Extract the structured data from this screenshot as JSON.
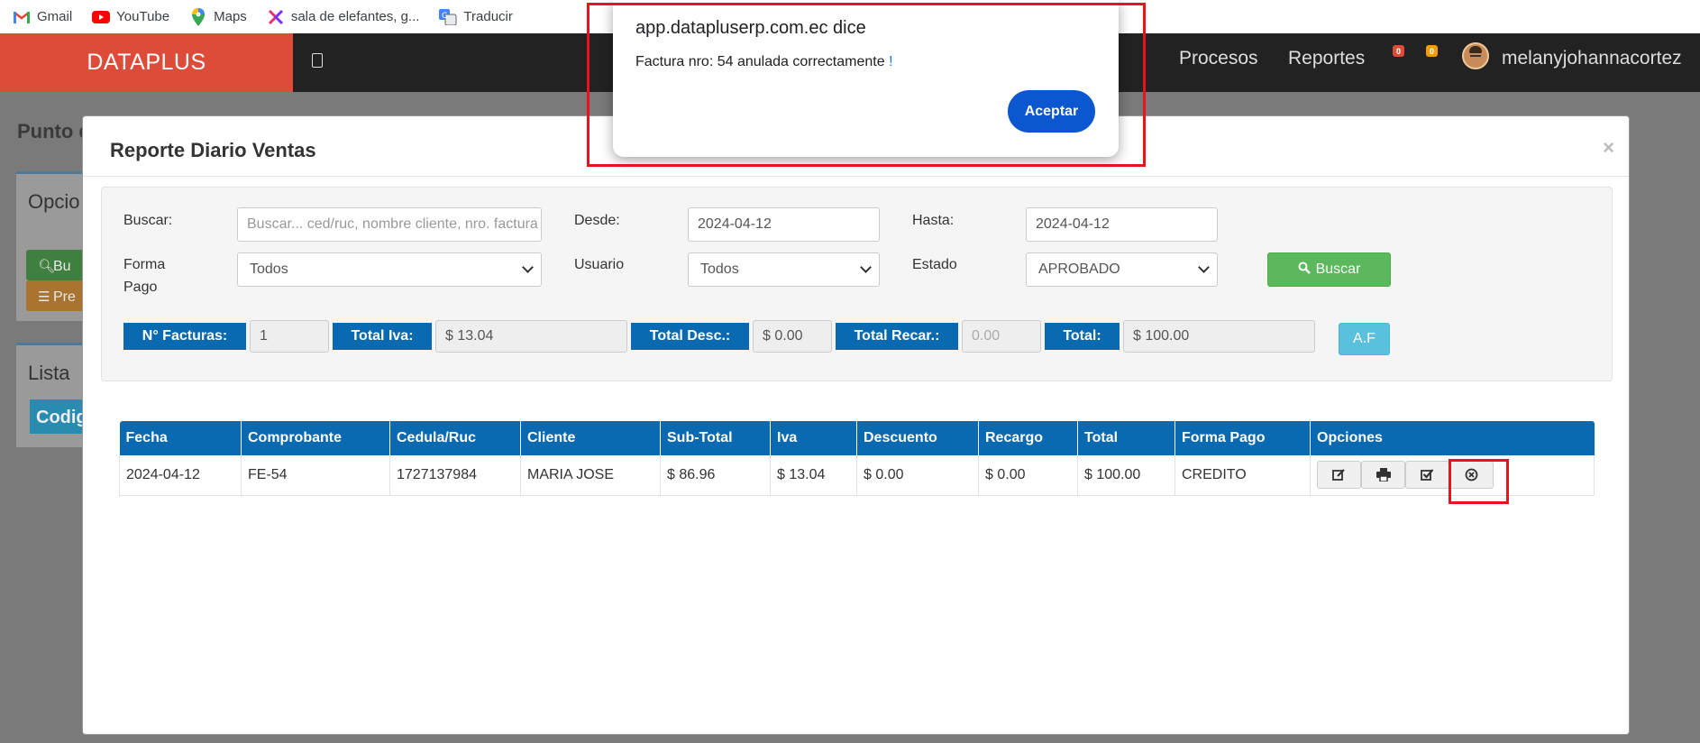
{
  "bookmarks": [
    {
      "label": "Gmail",
      "icon": "gmail-icon"
    },
    {
      "label": "YouTube",
      "icon": "youtube-icon"
    },
    {
      "label": "Maps",
      "icon": "maps-pin-icon"
    },
    {
      "label": "sala de elefantes, g...",
      "icon": "site-logo-icon"
    },
    {
      "label": "Traducir",
      "icon": "translate-icon"
    }
  ],
  "navbar": {
    "brand": "DATAPLUS",
    "links": [
      "Procesos",
      "Reportes"
    ],
    "badges": [
      "0",
      "0"
    ],
    "user": "melanyjohannacortez"
  },
  "background": {
    "page_title": "Punto d",
    "options_title": "Opcio",
    "btn_search": "Bu",
    "btn_list": "Pre",
    "list_title": "Lista",
    "codigo": "Codig"
  },
  "modal": {
    "title": "Reporte Diario Ventas",
    "close": "×",
    "filters": {
      "buscar_label": "Buscar:",
      "buscar_placeholder": "Buscar... ced/ruc, nombre cliente, nro. factura",
      "desde_label": "Desde:",
      "desde_value": "2024-04-12",
      "hasta_label": "Hasta:",
      "hasta_value": "2024-04-12",
      "forma_pago_label_1": "Forma",
      "forma_pago_label_2": "Pago",
      "forma_pago_value": "Todos",
      "usuario_label": "Usuario",
      "usuario_value": "Todos",
      "estado_label": "Estado",
      "estado_value": "APROBADO",
      "buscar_button": "Buscar"
    },
    "totals": {
      "facturas_label": "N° Facturas:",
      "facturas_value": "1",
      "iva_label": "Total Iva:",
      "iva_value": "$ 13.04",
      "desc_label": "Total Desc.:",
      "desc_value": "$ 0.00",
      "recar_label": "Total Recar.:",
      "recar_value": "0.00",
      "total_label": "Total:",
      "total_value": "$ 100.00",
      "af_button": "A.F"
    },
    "table": {
      "headers": [
        "Fecha",
        "Comprobante",
        "Cedula/Ruc",
        "Cliente",
        "Sub-Total",
        "Iva",
        "Descuento",
        "Recargo",
        "Total",
        "Forma Pago",
        "Opciones"
      ],
      "rows": [
        [
          "2024-04-12",
          "FE-54",
          "1727137984",
          "MARIA JOSE",
          "$ 86.96",
          "$ 13.04",
          "$ 0.00",
          "$ 0.00",
          "$ 100.00",
          "CREDITO"
        ]
      ]
    }
  },
  "alert": {
    "title": "app.datapluserp.com.ec dice",
    "message": "Factura nro: 54 anulada correctamente",
    "exclaim": "!",
    "button": "Aceptar"
  },
  "colors": {
    "brand": "#dd4b39",
    "navbar": "#222222",
    "table_header": "#0a6ab1",
    "success": "#5cb85c",
    "info": "#5bc0de",
    "alert_button": "#0b57d0",
    "highlight": "#e8141b"
  }
}
